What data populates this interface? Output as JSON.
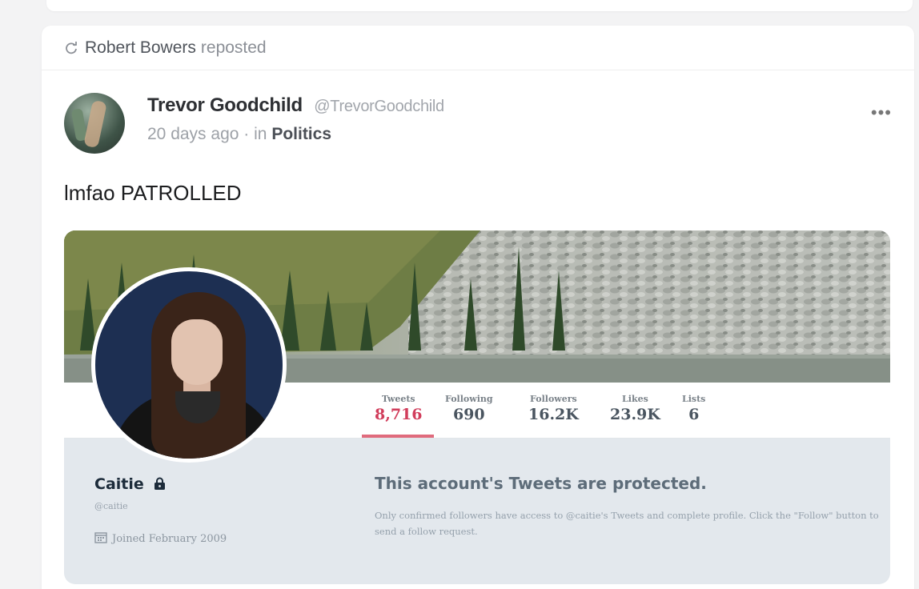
{
  "repost": {
    "user": "Robert Bowers",
    "action": "reposted"
  },
  "post": {
    "author_name": "Trevor Goodchild",
    "author_handle": "@TrevorGoodchild",
    "time": "20 days ago",
    "category_prefix": "· in",
    "category": "Politics",
    "more_label": "•••",
    "text": "lmfao PATROLLED"
  },
  "embed": {
    "stats": [
      {
        "label": "Tweets",
        "value": "8,716",
        "active": true
      },
      {
        "label": "Following",
        "value": "690"
      },
      {
        "label": "Followers",
        "value": "16.2K"
      },
      {
        "label": "Likes",
        "value": "23.9K"
      },
      {
        "label": "Lists",
        "value": "6"
      }
    ],
    "profile_name": "Caitie",
    "profile_handle": "@caitie",
    "joined": "Joined February 2009",
    "protected_title": "This account's Tweets are protected.",
    "protected_desc": "Only confirmed followers have access to @caitie's Tweets and complete profile. Click the \"Follow\" button to send a follow request."
  },
  "colors": {
    "accent_stat": "#d13d5b",
    "underline": "#e06b7d"
  },
  "icons": {
    "repost": "repost-icon",
    "lock": "lock-icon",
    "calendar": "calendar-icon",
    "more": "more-icon"
  }
}
